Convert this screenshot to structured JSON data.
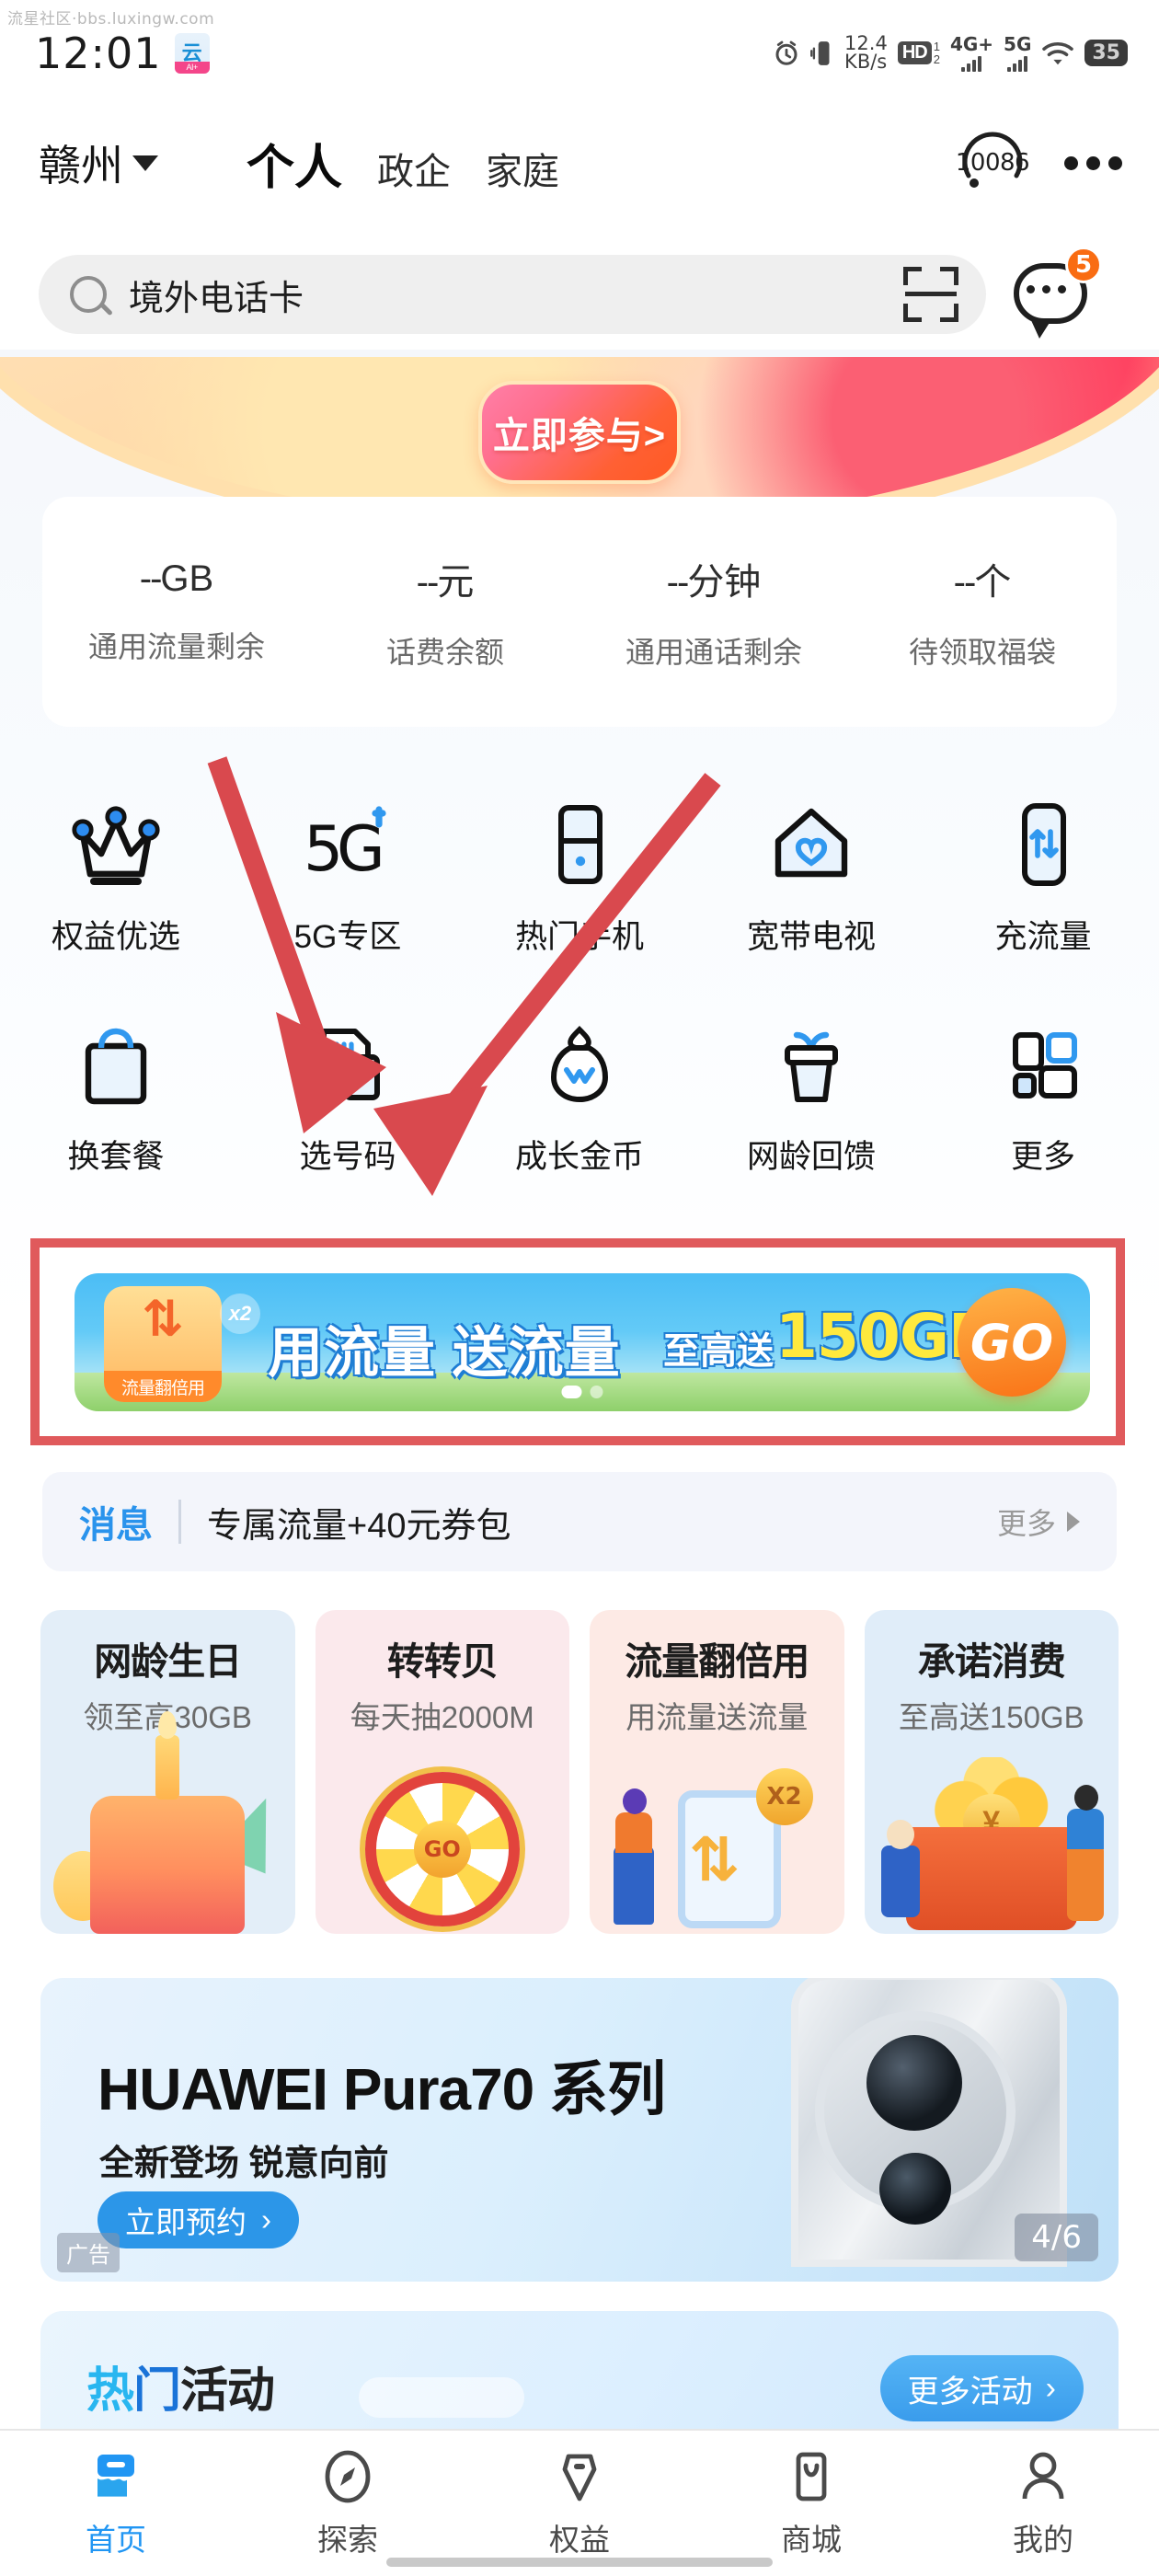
{
  "watermark": "流星社区·bbs.luxingw.com",
  "status_bar": {
    "time": "12:01",
    "cloud_badge": "云",
    "cloud_badge_sub": "AI+",
    "net_speed_value": "12.4",
    "net_speed_unit": "KB/s",
    "hd_label": "HD",
    "hd_slot_top": "1",
    "hd_slot_bottom": "2",
    "sim1_label": "4G+",
    "sim2_label": "5G",
    "battery": "35"
  },
  "header": {
    "location": "赣州",
    "tabs": [
      {
        "label": "个人",
        "active": true
      },
      {
        "label": "政企",
        "active": false
      },
      {
        "label": "家庭",
        "active": false
      }
    ],
    "service_number": "10086",
    "more_icon": "ellipsis-icon"
  },
  "search": {
    "value": "境外电话卡",
    "scan_icon": "scan-icon",
    "chat_icon": "chat-bubble-icon",
    "chat_badge": "5"
  },
  "promo_banner": {
    "cta_label": "立即参与>"
  },
  "stats": [
    {
      "value": "--",
      "unit": "GB",
      "label": "通用流量剩余"
    },
    {
      "value": "--",
      "unit": "元",
      "label": "话费余额"
    },
    {
      "value": "--",
      "unit": "分钟",
      "label": "通用通话剩余"
    },
    {
      "value": "--",
      "unit": "个",
      "label": "待领取福袋"
    }
  ],
  "quick_grid": [
    {
      "label": "权益优选",
      "icon": "crown-icon"
    },
    {
      "label": "5G专区",
      "icon": "5g-plus-icon"
    },
    {
      "label": "热门手机",
      "icon": "phone-icon"
    },
    {
      "label": "宽带电视",
      "icon": "home-heart-icon"
    },
    {
      "label": "充流量",
      "icon": "data-recharge-icon"
    },
    {
      "label": "换套餐",
      "icon": "shopping-bag-icon"
    },
    {
      "label": "选号码",
      "icon": "sim-card-icon"
    },
    {
      "label": "成长金币",
      "icon": "coin-bag-icon"
    },
    {
      "label": "网龄回馈",
      "icon": "gift-cup-icon"
    },
    {
      "label": "更多",
      "icon": "grid-more-icon"
    }
  ],
  "highlighted_banner": {
    "badge_caption": "流量翻倍用",
    "badge_multiplier": "x2",
    "main_text": "用流量 送流量",
    "sub_text": "至高送",
    "amount_text": "150GB",
    "go_label": "GO",
    "dots_total": 2,
    "dots_active": 1
  },
  "message_bar": {
    "title": "消息",
    "text": "专属流量+40元券包",
    "more_label": "更多"
  },
  "promo_cards": [
    {
      "title": "网龄生日",
      "subtitle": "领至高30GB",
      "art": "birthday-cake"
    },
    {
      "title": "转转贝",
      "subtitle": "每天抽2000M",
      "art": "prize-wheel"
    },
    {
      "title": "流量翻倍用",
      "subtitle": "用流量送流量",
      "art": "data-double"
    },
    {
      "title": "承诺消费",
      "subtitle": "至高送150GB",
      "art": "treasure-chest"
    }
  ],
  "ad": {
    "title": "HUAWEI Pura70 系列",
    "subtitle": "全新登场 锐意向前",
    "cta_label": "立即预约",
    "tag": "广告",
    "counter": "4/6"
  },
  "hot_section": {
    "title_part1": "热",
    "title_part2": "门",
    "title_part3": "活动",
    "more_label": "更多活动"
  },
  "bottom_nav": [
    {
      "label": "首页",
      "icon": "home-icon",
      "active": true
    },
    {
      "label": "探索",
      "icon": "compass-icon",
      "active": false
    },
    {
      "label": "权益",
      "icon": "pen-nib-icon",
      "active": false
    },
    {
      "label": "商城",
      "icon": "store-icon",
      "active": false
    },
    {
      "label": "我的",
      "icon": "person-icon",
      "active": false
    }
  ],
  "annotations": {
    "arrow_color": "#d9494e",
    "highlight_box_color": "#e05a5c",
    "arrow1_target": "选号码",
    "arrow2_target": "选号码"
  },
  "colors": {
    "accent_blue": "#2196f3",
    "badge_orange": "#f96c12",
    "annotation_red": "#d9494e"
  }
}
